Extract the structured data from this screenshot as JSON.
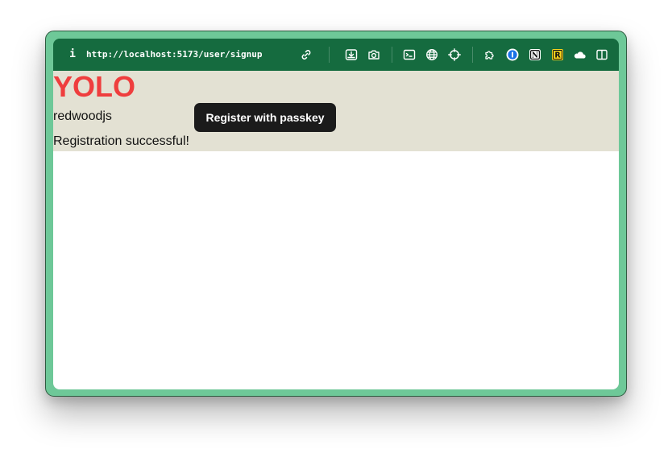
{
  "browser": {
    "url": "http://localhost:5173/user/signup",
    "info_label": "i",
    "toolbar_icons": [
      "link-icon",
      "download-icon",
      "camera-icon",
      "terminal-icon",
      "globe-icon",
      "crosshair-icon",
      "puzzle-icon",
      "onepassword-icon",
      "notion-icon",
      "r-extension-icon",
      "cloud-extension-icon",
      "sidebar-icon"
    ],
    "extension_labels": {
      "onepassword": "1",
      "notion": "N",
      "r_extension": "R"
    },
    "colors": {
      "frame": "#6ec898",
      "toolbar": "#156b3f",
      "app_background": "#e3e1d3",
      "title": "#ef3e3e",
      "button": "#1b1b1b"
    }
  },
  "page": {
    "title": "YOLO",
    "brand": "redwoodjs",
    "register_button_label": "Register with passkey",
    "status_message": "Registration successful!"
  }
}
